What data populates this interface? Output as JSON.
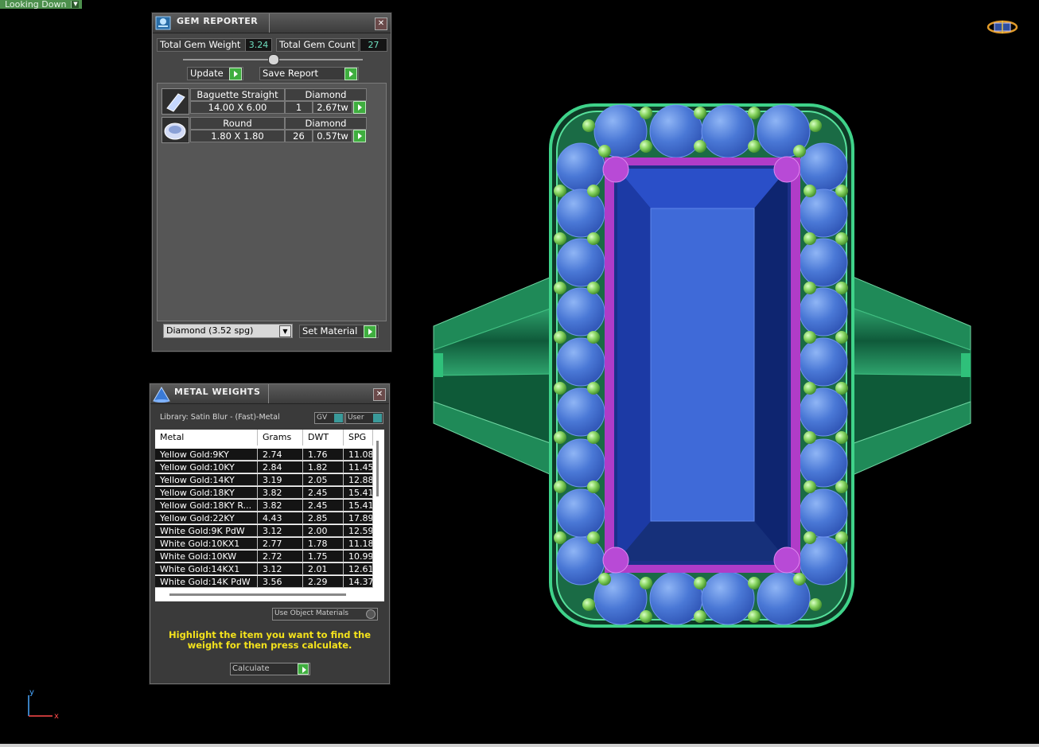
{
  "viewport": {
    "label": "Looking Down"
  },
  "gem_reporter": {
    "title": "GEM REPORTER",
    "total_weight_label": "Total Gem Weight",
    "total_weight_value": "3.24",
    "total_count_label": "Total Gem Count",
    "total_count_value": "27",
    "update_label": "Update",
    "save_report_label": "Save Report",
    "gems": [
      {
        "shape": "Baguette Straight",
        "material": "Diamond",
        "size": "14.00 X 6.00",
        "count": "1",
        "weight": "2.67tw"
      },
      {
        "shape": "Round",
        "material": "Diamond",
        "size": "1.80 X 1.80",
        "count": "26",
        "weight": "0.57tw"
      }
    ],
    "material_select": "Diamond     (3.52 spg)",
    "set_material_label": "Set Material"
  },
  "metal_weights": {
    "title": "METAL WEIGHTS",
    "library": "Library: Satin Blur - (Fast)-Metal",
    "gv_label": "GV",
    "user_label": "User",
    "columns": [
      "Metal",
      "Grams",
      "DWT",
      "SPG"
    ],
    "rows": [
      [
        "Yellow Gold:9KY",
        "2.74",
        "1.76",
        "11.08"
      ],
      [
        "Yellow Gold:10KY",
        "2.84",
        "1.82",
        "11.45"
      ],
      [
        "Yellow Gold:14KY",
        "3.19",
        "2.05",
        "12.88"
      ],
      [
        "Yellow Gold:18KY",
        "3.82",
        "2.45",
        "15.41"
      ],
      [
        "Yellow Gold:18KY R...",
        "3.82",
        "2.45",
        "15.41"
      ],
      [
        "Yellow Gold:22KY",
        "4.43",
        "2.85",
        "17.89"
      ],
      [
        "White Gold:9K PdW",
        "3.12",
        "2.00",
        "12.59"
      ],
      [
        "White Gold:10KX1",
        "2.77",
        "1.78",
        "11.18"
      ],
      [
        "White Gold:10KW",
        "2.72",
        "1.75",
        "10.99"
      ],
      [
        "White Gold:14KX1",
        "3.12",
        "2.01",
        "12.61"
      ],
      [
        "White Gold:14K PdW",
        "3.56",
        "2.29",
        "14.37"
      ]
    ],
    "use_object_materials": "Use Object Materials",
    "instruction": "Highlight the item you want to find the weight for then press calculate.",
    "calculate_label": "Calculate"
  },
  "axis": {
    "y": "y",
    "x": "x"
  },
  "colors": {
    "metal_green": "#2fa36a",
    "halo_blue": "#4a78d6",
    "center_stone": "#1e3fa8",
    "prong_purple": "#b03cc8",
    "bead_green": "#9be27a"
  }
}
